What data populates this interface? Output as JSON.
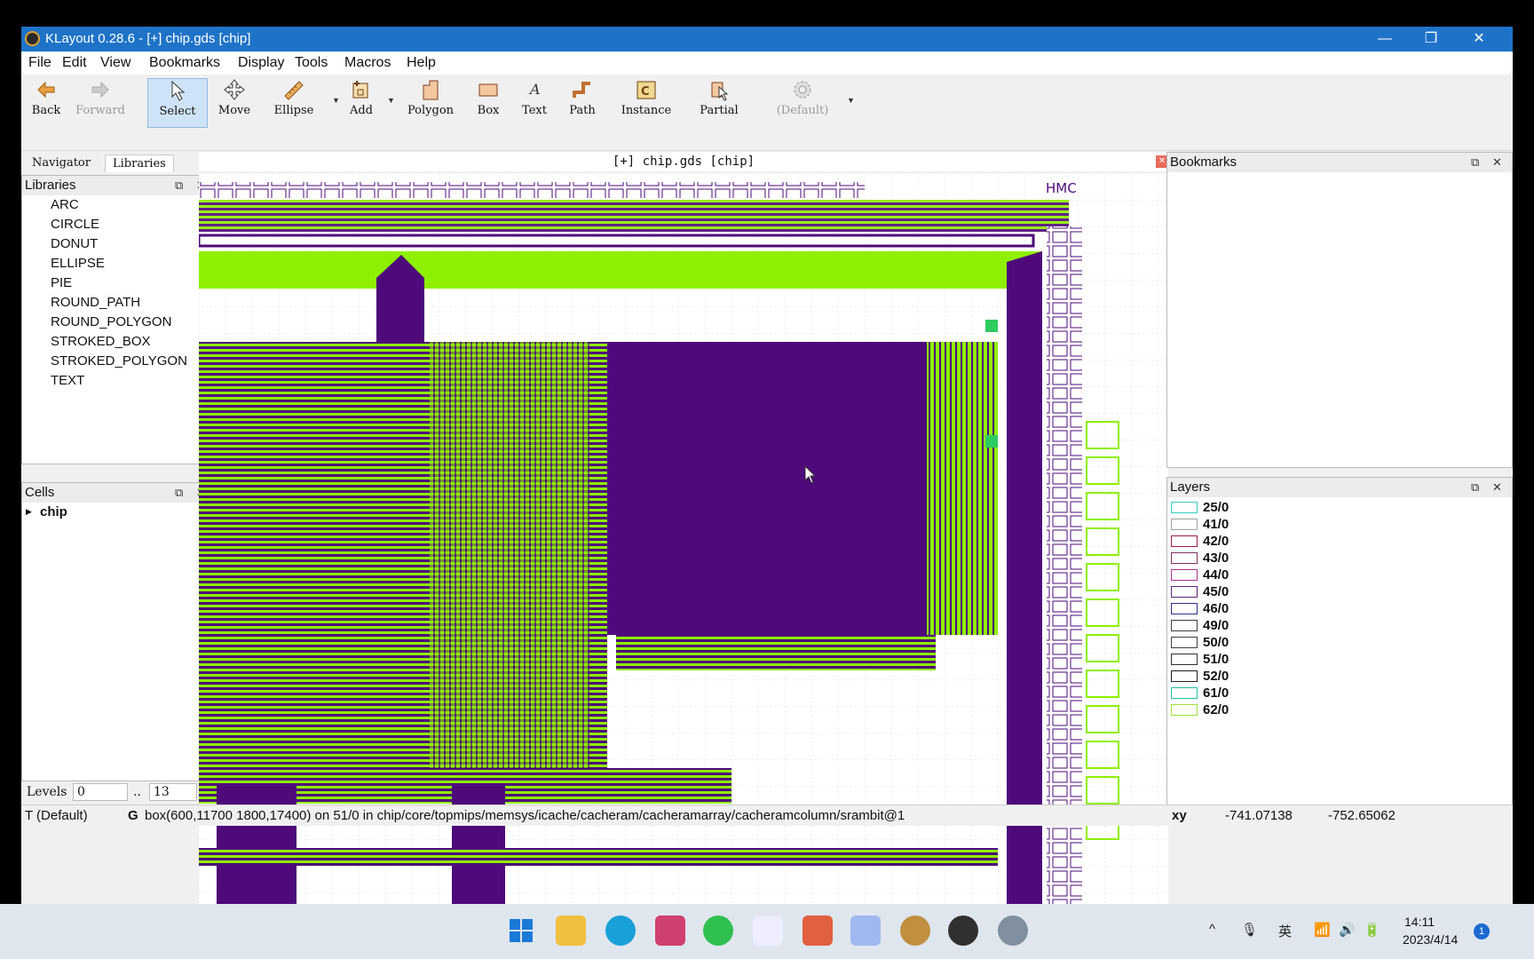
{
  "window": {
    "title": "KLayout 0.28.6 - [+] chip.gds [chip]",
    "minimize": "—",
    "restore": "❐",
    "close": "✕"
  },
  "menu": [
    "File",
    "Edit",
    "View",
    "Bookmarks",
    "Display",
    "Tools",
    "Macros",
    "Help"
  ],
  "toolbar": {
    "back": "Back",
    "forward": "Forward",
    "select": "Select",
    "move": "Move",
    "ellipse": "Ellipse",
    "add": "Add",
    "polygon": "Polygon",
    "box": "Box",
    "text": "Text",
    "path": "Path",
    "instance": "Instance",
    "partial": "Partial",
    "default_style": "(Default)"
  },
  "left_tabs": {
    "navigator": "Navigator",
    "libraries": "Libraries"
  },
  "libraries": {
    "title": "Libraries",
    "items": [
      "ARC",
      "CIRCLE",
      "DONUT",
      "ELLIPSE",
      "PIE",
      "ROUND_PATH",
      "ROUND_POLYGON",
      "STROKED_BOX",
      "STROKED_POLYGON",
      "TEXT"
    ]
  },
  "cells": {
    "title": "Cells",
    "root": "chip"
  },
  "levels": {
    "label": "Levels",
    "from": "0",
    "sep": "..",
    "to": "13"
  },
  "canvas": {
    "title": "[+] chip.gds [chip]",
    "label": "HMC"
  },
  "bookmarks": {
    "title": "Bookmarks"
  },
  "layers": {
    "title": "Layers",
    "items": [
      {
        "name": "25/0",
        "color": "#3ad0c0"
      },
      {
        "name": "41/0",
        "color": "#a0a0a0"
      },
      {
        "name": "42/0",
        "color": "#a02040"
      },
      {
        "name": "43/0",
        "color": "#803060"
      },
      {
        "name": "44/0",
        "color": "#b03090"
      },
      {
        "name": "45/0",
        "color": "#602080"
      },
      {
        "name": "46/0",
        "color": "#303090"
      },
      {
        "name": "49/0",
        "color": "#404040"
      },
      {
        "name": "50/0",
        "color": "#404040"
      },
      {
        "name": "51/0",
        "color": "#303030"
      },
      {
        "name": "52/0",
        "color": "#202020"
      },
      {
        "name": "61/0",
        "color": "#20c0a0"
      },
      {
        "name": "62/0",
        "color": "#a0e040"
      }
    ]
  },
  "status": {
    "text_style": "T (Default)",
    "grid_flag": "G",
    "message": "box(600,11700 1800,17400) on 51/0 in chip/core/topmips/memsys/icache/cacheram/cacheramarray/cacheramcolumn/srambit@1",
    "xy_label": "xy",
    "x": "-741.07138",
    "y": "-752.65062"
  },
  "taskbar": {
    "time": "14:11",
    "date": "2023/4/14",
    "ime": "英",
    "badge": "1"
  },
  "colors": {
    "purple": "#4e0a7a",
    "green": "#8ef000",
    "titlebar": "#1e73c8"
  }
}
